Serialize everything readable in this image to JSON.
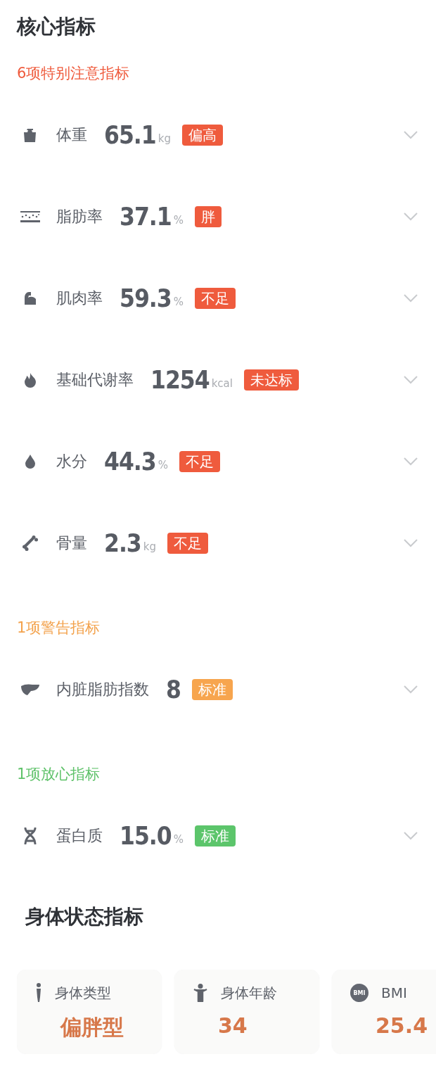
{
  "title": "核心指标",
  "groups": [
    {
      "heading": "6项特别注意指标",
      "color": "#ef5b3d",
      "metrics": [
        {
          "kind": "weight",
          "label": "体重",
          "value": "65.1",
          "unit": "kg",
          "badge": "偏高",
          "color": "#ef5b3d"
        },
        {
          "kind": "fat",
          "label": "脂肪率",
          "value": "37.1",
          "unit": "%",
          "badge": "胖",
          "color": "#ef5b3d"
        },
        {
          "kind": "muscle",
          "label": "肌肉率",
          "value": "59.3",
          "unit": "%",
          "badge": "不足",
          "color": "#ef5b3d"
        },
        {
          "kind": "flame",
          "label": "基础代谢率",
          "value": "1254",
          "unit": "kcal",
          "badge": "未达标",
          "color": "#ef5b3d"
        },
        {
          "kind": "drop",
          "label": "水分",
          "value": "44.3",
          "unit": "%",
          "badge": "不足",
          "color": "#ef5b3d"
        },
        {
          "kind": "bone",
          "label": "骨量",
          "value": "2.3",
          "unit": "kg",
          "badge": "不足",
          "color": "#ef5b3d"
        }
      ]
    },
    {
      "heading": "1项警告指标",
      "color": "#f3a24c",
      "metrics": [
        {
          "kind": "liver",
          "label": "内脏脂肪指数",
          "value": "8",
          "badge": "标准",
          "color": "#f7a54e"
        }
      ]
    },
    {
      "heading": "1项放心指标",
      "color": "#5fc26a",
      "metrics": [
        {
          "kind": "dna",
          "label": "蛋白质",
          "value": "15.0",
          "unit": "%",
          "badge": "标准",
          "color": "#5cc56b"
        }
      ]
    }
  ],
  "status_title": "身体状态指标",
  "cards": [
    {
      "kind": "figure",
      "label": "身体类型",
      "value": "偏胖型"
    },
    {
      "kind": "person",
      "label": "身体年龄",
      "value": "34"
    },
    {
      "kind": "badge",
      "icon_text": "BMI",
      "label": "BMI",
      "value": "25.4"
    }
  ]
}
